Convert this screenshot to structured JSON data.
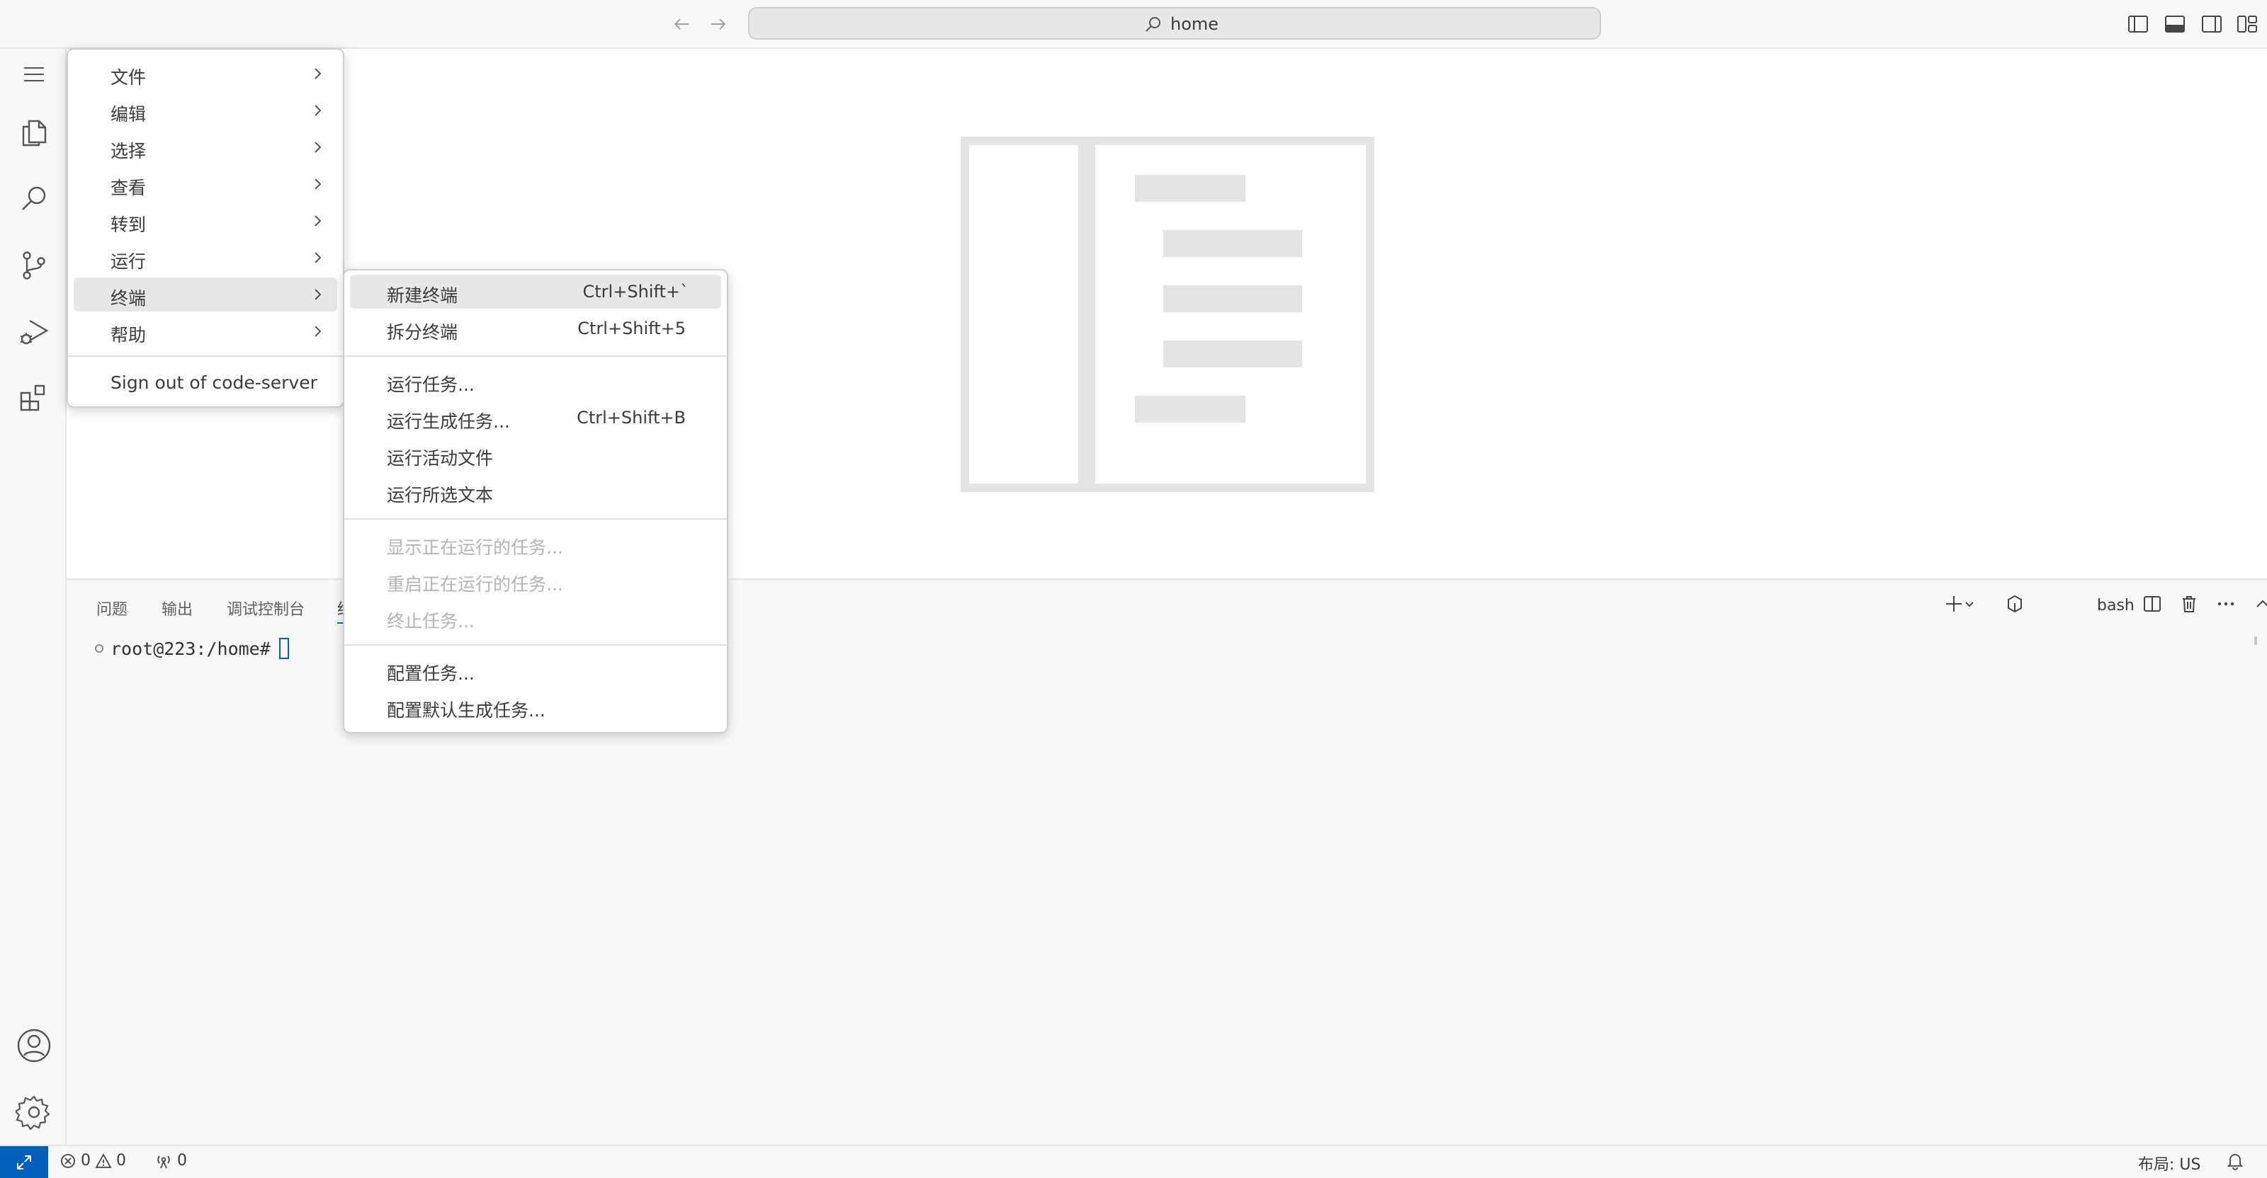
{
  "titlebar": {
    "search_text": "home"
  },
  "main_menu": {
    "items": [
      {
        "label": "文件"
      },
      {
        "label": "编辑"
      },
      {
        "label": "选择"
      },
      {
        "label": "查看"
      },
      {
        "label": "转到"
      },
      {
        "label": "运行"
      },
      {
        "label": "终端"
      },
      {
        "label": "帮助"
      }
    ],
    "sign_out": "Sign out of code-server"
  },
  "terminal_menu": {
    "items": [
      {
        "label": "新建终端",
        "shortcut": "Ctrl+Shift+`"
      },
      {
        "label": "拆分终端",
        "shortcut": "Ctrl+Shift+5"
      },
      {
        "label": "运行任务..."
      },
      {
        "label": "运行生成任务...",
        "shortcut": "Ctrl+Shift+B"
      },
      {
        "label": "运行活动文件"
      },
      {
        "label": "运行所选文本"
      },
      {
        "label": "显示正在运行的任务..."
      },
      {
        "label": "重启正在运行的任务..."
      },
      {
        "label": "终止任务..."
      },
      {
        "label": "配置任务..."
      },
      {
        "label": "配置默认生成任务..."
      }
    ]
  },
  "panel": {
    "tabs": [
      "问题",
      "输出",
      "调试控制台",
      "终"
    ],
    "terminal_profile": "bash",
    "prompt": "root@223:/home#"
  },
  "statusbar": {
    "errors": "0",
    "warnings": "0",
    "ports": "0",
    "layout": "布局: US"
  },
  "colors": {
    "accent": "#005fb8",
    "background": "#f8f8f8",
    "menu_highlight": "#e8e8e8"
  }
}
